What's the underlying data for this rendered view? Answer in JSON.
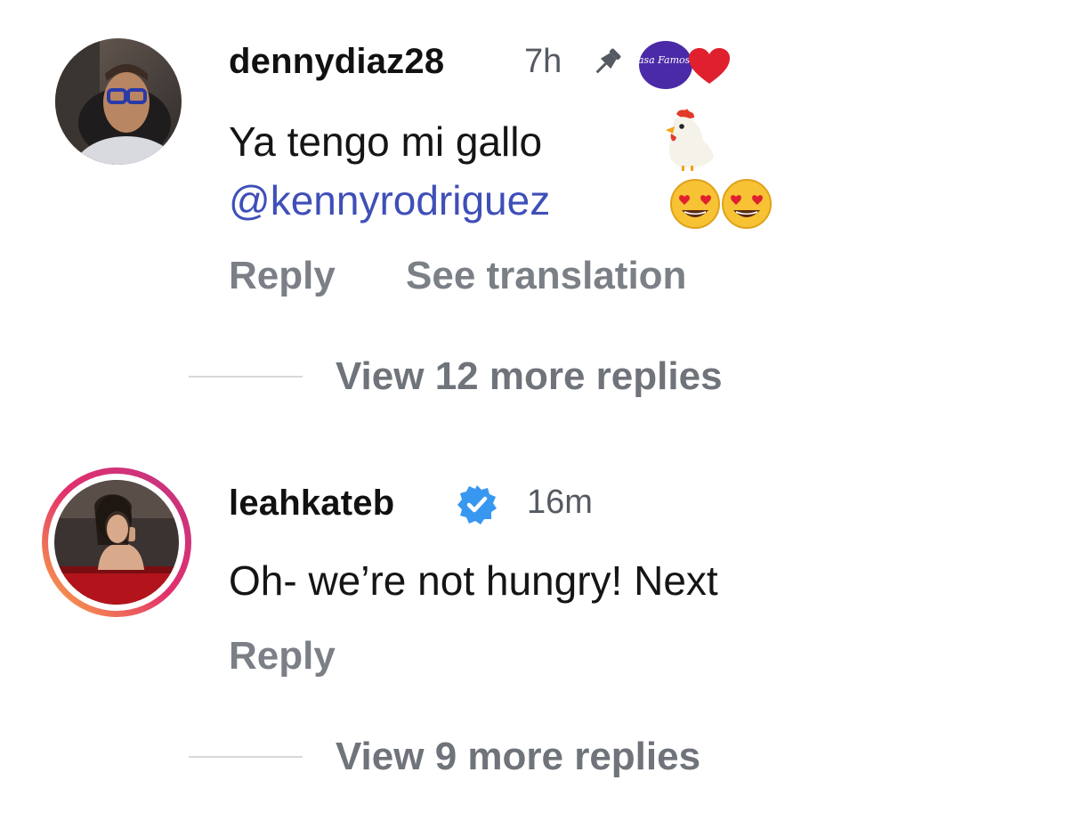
{
  "comments": [
    {
      "username": "dennydiaz28",
      "time": "7h",
      "pinned_icon": "pin-icon",
      "badge": {
        "icon": "la-casa-de-los-famosos-logo-icon",
        "logo_text": "Casa Famosos",
        "heart_icon": "red-heart-icon",
        "heart_color": "#e0202e"
      },
      "text": "Ya tengo mi gallo",
      "text_emoji_icon": "rooster-emoji-icon",
      "mention": "@kennyrodriguez",
      "mention_emoji_icons": [
        "heart-eyes-emoji-icon",
        "heart-eyes-emoji-icon"
      ],
      "actions": {
        "reply": "Reply",
        "translate": "See translation"
      },
      "more_replies": "View 12 more replies"
    },
    {
      "username": "leahkateb",
      "verified_icon": "verified-badge-icon",
      "verified_color": "#3897f0",
      "time": "16m",
      "text": "Oh- we’re not hungry! Next",
      "actions": {
        "reply": "Reply"
      },
      "more_replies": "View 9 more replies"
    }
  ],
  "colors": {
    "mention": "#3f4fb8",
    "muted": "#7b7f86",
    "story_ring_start": "#c13584",
    "story_ring_end": "#fcaf45"
  }
}
